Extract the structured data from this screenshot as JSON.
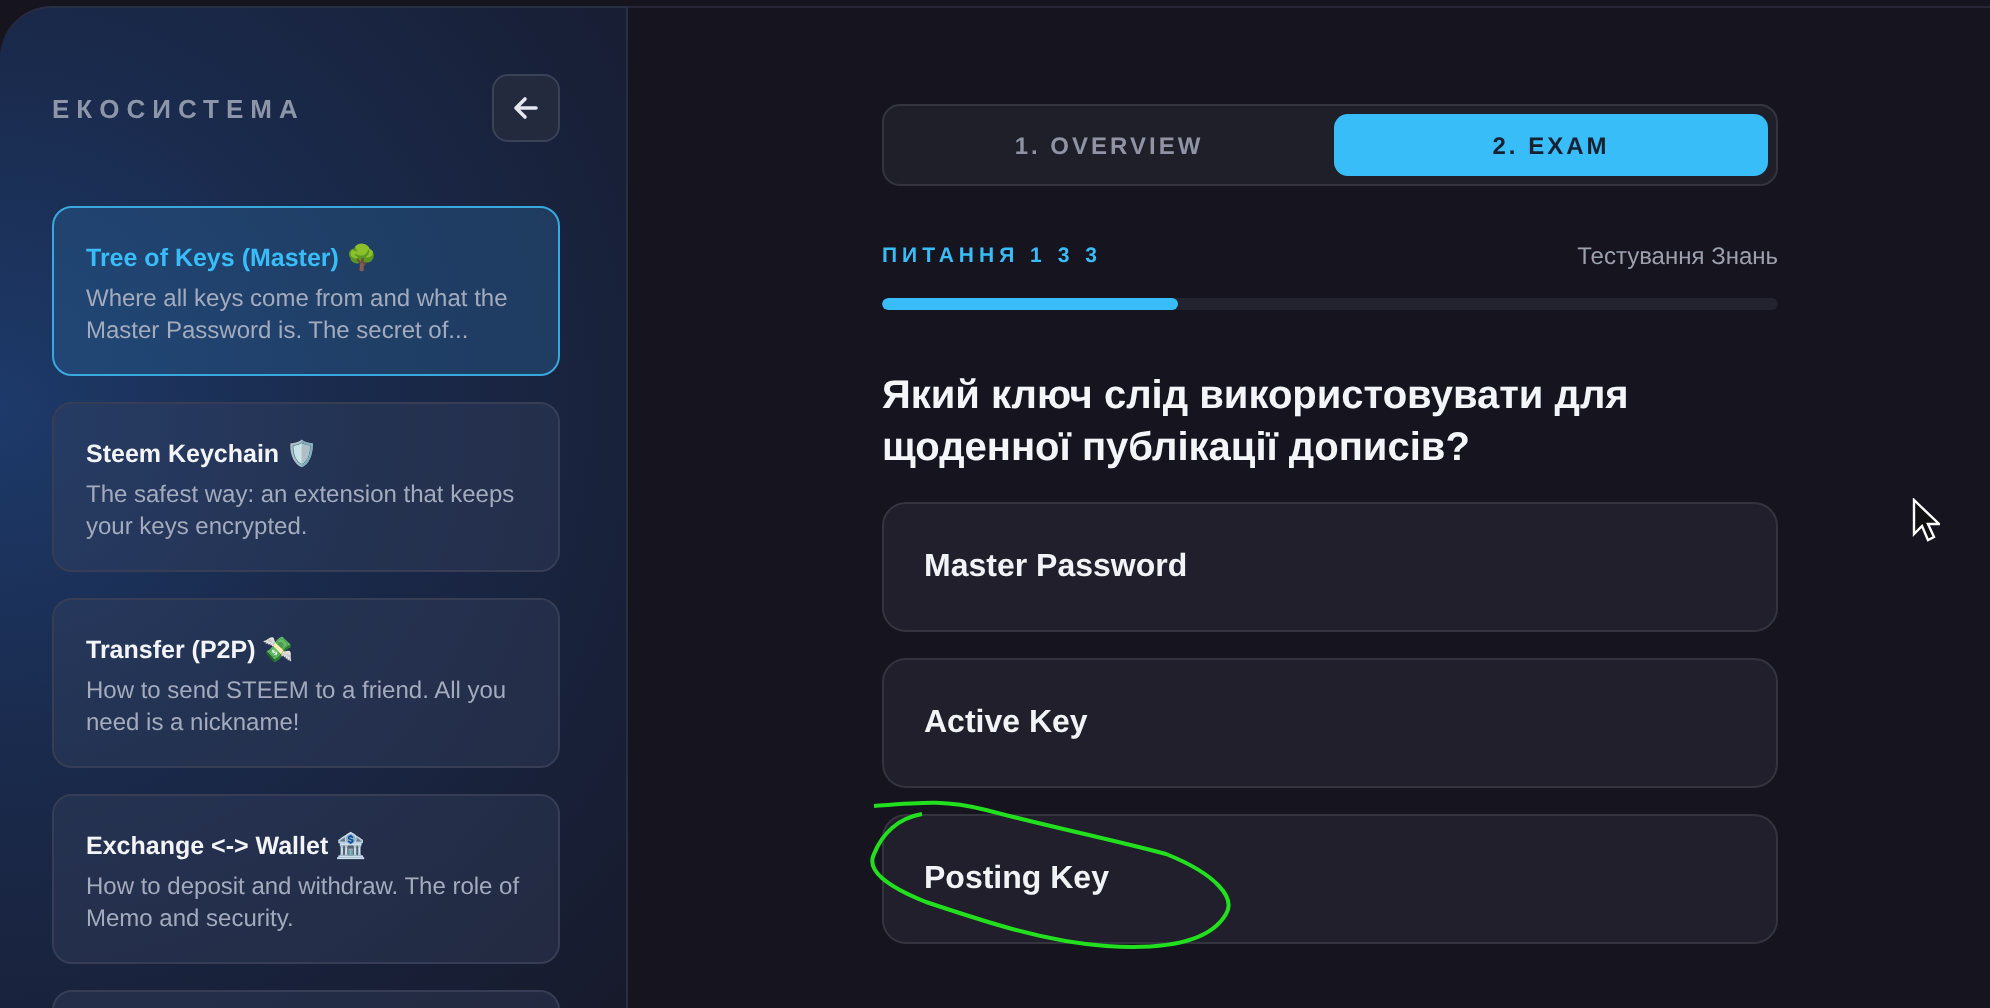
{
  "sidebar": {
    "title": "ЕКОСИСТЕМА",
    "items": [
      {
        "title": "Tree of Keys (Master) 🌳",
        "description": "Where all keys come from and what the Master Password is. The secret of...",
        "selected": true
      },
      {
        "title": "Steem Keychain 🛡️",
        "description": "The safest way: an extension that keeps your keys encrypted.",
        "selected": false
      },
      {
        "title": "Transfer (P2P) 💸",
        "description": "How to send STEEM to a friend. All you need is a nickname!",
        "selected": false
      },
      {
        "title": "Exchange <-> Wallet 🏦",
        "description": "How to deposit and withdraw. The role of Memo and security.",
        "selected": false
      }
    ]
  },
  "tabs": [
    {
      "label": "1. OVERVIEW",
      "selected": false
    },
    {
      "label": "2. EXAM",
      "selected": true
    }
  ],
  "progress": {
    "label": "ПИТАННЯ 1 3 3",
    "caption": "Тестування Знань",
    "level": 0.33
  },
  "question": "Який ключ слід використовувати для щоденної публікації дописів?",
  "options": [
    {
      "label": "Master Password",
      "circled": false
    },
    {
      "label": "Active Key",
      "circled": false
    },
    {
      "label": "Posting Key",
      "circled": true
    }
  ]
}
